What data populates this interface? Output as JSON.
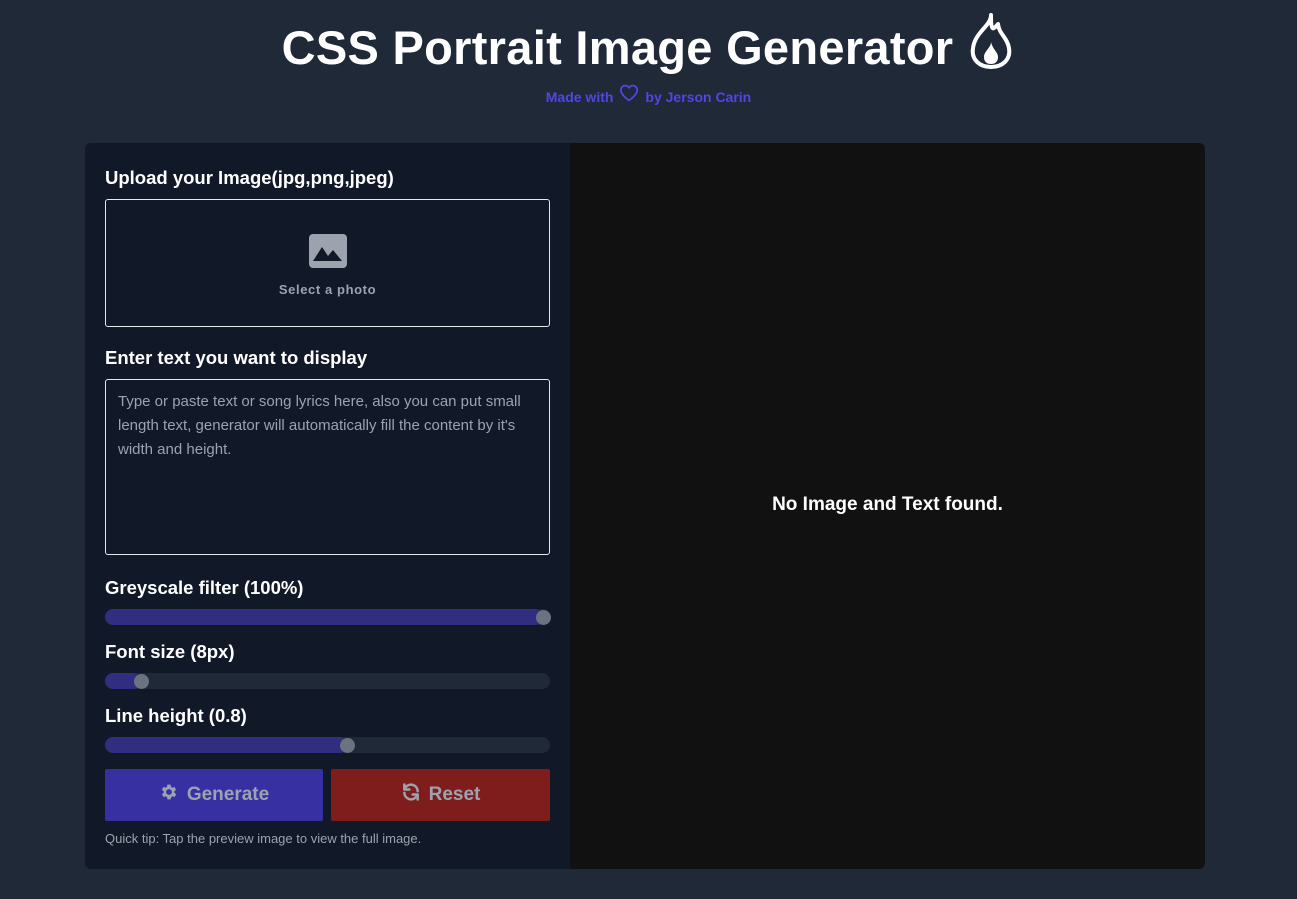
{
  "header": {
    "title": "CSS Portrait Image Generator",
    "title_icon": "fire-icon",
    "made_with": "Made with",
    "heart_icon": "heart-icon",
    "by": "by Jerson Carin",
    "accent_color": "#4f46e5"
  },
  "upload": {
    "label": "Upload your Image(jpg,png,jpeg)",
    "icon": "image-icon",
    "hint": "Select a photo"
  },
  "text_input": {
    "label": "Enter text you want to display",
    "placeholder": "Type or paste text or song lyrics here, also you can put small length text, generator will automatically fill the content by it's width and height.",
    "value": ""
  },
  "controls": {
    "greyscale": {
      "label": "Greyscale filter (100%)",
      "value": 100,
      "min": 0,
      "max": 100
    },
    "font_size": {
      "label": "Font size (8px)",
      "value": 8,
      "min": 5,
      "max": 50
    },
    "line_height": {
      "label": "Line height (0.8)",
      "value": 0.8,
      "min": 0.5,
      "max": 1.05
    }
  },
  "buttons": {
    "generate": {
      "label": "Generate",
      "icon": "gear-icon",
      "color": "#3730a3"
    },
    "reset": {
      "label": "Reset",
      "icon": "refresh-icon",
      "color": "#7f1d1d"
    }
  },
  "tip": "Quick tip: Tap the preview image to view the full image.",
  "preview": {
    "empty_message": "No Image and Text found."
  }
}
